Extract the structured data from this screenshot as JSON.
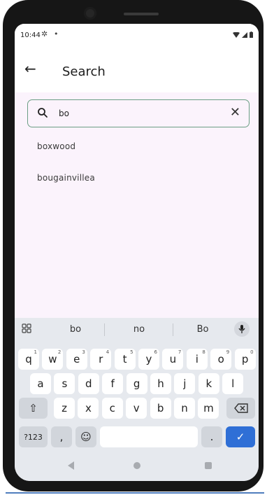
{
  "status_bar": {
    "time": "10:44",
    "gear_icon": "gear-icon",
    "dot": "•"
  },
  "app_bar": {
    "back_icon": "arrow-left-icon",
    "title": "Search"
  },
  "search": {
    "query": "bo",
    "clear_glyph": "✕"
  },
  "results": [
    {
      "label": "boxwood"
    },
    {
      "label": "bougainvillea"
    }
  ],
  "keyboard": {
    "suggestions": [
      "bo",
      "no",
      "Bo"
    ],
    "row1": [
      {
        "k": "q",
        "h": "1"
      },
      {
        "k": "w",
        "h": "2"
      },
      {
        "k": "e",
        "h": "3"
      },
      {
        "k": "r",
        "h": "4"
      },
      {
        "k": "t",
        "h": "5"
      },
      {
        "k": "y",
        "h": "6"
      },
      {
        "k": "u",
        "h": "7"
      },
      {
        "k": "i",
        "h": "8"
      },
      {
        "k": "o",
        "h": "9"
      },
      {
        "k": "p",
        "h": "0"
      }
    ],
    "row2": [
      "a",
      "s",
      "d",
      "f",
      "g",
      "h",
      "j",
      "k",
      "l"
    ],
    "row3": [
      "z",
      "x",
      "c",
      "v",
      "b",
      "n",
      "m"
    ],
    "symbols_label": "?123",
    "comma_label": ",",
    "period_label": ".",
    "emoji_glyph": "☺",
    "shift_glyph": "⇧",
    "enter_glyph": "✓",
    "accent_color": "#2f6fd6"
  },
  "colors": {
    "content_bg": "#fbf3fc",
    "search_border": "#6b9e84",
    "keyboard_bg": "#e6e9ee"
  }
}
